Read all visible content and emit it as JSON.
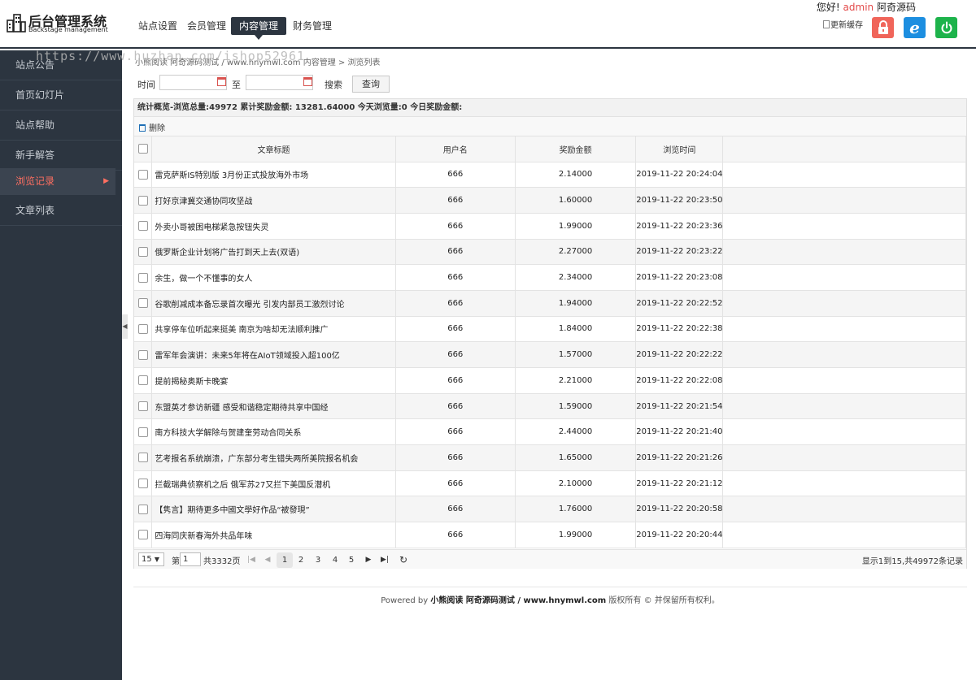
{
  "header": {
    "logo_title": "后台管理系统",
    "logo_sub": "Backstage management",
    "nav": [
      {
        "label": "站点设置"
      },
      {
        "label": "会员管理"
      },
      {
        "label": "内容管理"
      },
      {
        "label": "财务管理"
      }
    ],
    "greeting_prefix": "您好!",
    "username": "admin",
    "site_name": "阿奇源码",
    "cache_label": "更新缓存"
  },
  "sidebar": {
    "items": [
      {
        "label": "站点公告"
      },
      {
        "label": "首页幻灯片"
      },
      {
        "label": "站点帮助"
      },
      {
        "label": "新手解答"
      },
      {
        "label": "浏览记录"
      },
      {
        "label": "文章列表"
      }
    ]
  },
  "watermark": "https://www.huzhan.com/ishop52961",
  "breadcrumb": "小熊阅读 阿奇源码测试 / www.hnymwl.com 内容管理 > 浏览列表",
  "search": {
    "time_label": "时间",
    "to_label": "至",
    "search_label": "搜索",
    "query_button": "查询",
    "start_date": "",
    "end_date": ""
  },
  "stats": "统计概览-浏览总量:49972 累计奖励金额: 13281.64000 今天浏览量:0 今日奖励金额:",
  "toolbar": {
    "delete_label": "删除"
  },
  "table": {
    "columns": [
      "文章标题",
      "用户名",
      "奖励金额",
      "浏览时间"
    ],
    "rows": [
      {
        "title": "雷克萨斯IS特别版 3月份正式投放海外市场",
        "user": "666",
        "amount": "2.14000",
        "time": "2019-11-22 20:24:04"
      },
      {
        "title": "打好京津冀交通协同攻坚战",
        "user": "666",
        "amount": "1.60000",
        "time": "2019-11-22 20:23:50"
      },
      {
        "title": "外卖小哥被困电梯紧急按钮失灵",
        "user": "666",
        "amount": "1.99000",
        "time": "2019-11-22 20:23:36"
      },
      {
        "title": "俄罗斯企业计划将广告打到天上去(双语)",
        "user": "666",
        "amount": "2.27000",
        "time": "2019-11-22 20:23:22"
      },
      {
        "title": "余生，做一个不懂事的女人",
        "user": "666",
        "amount": "2.34000",
        "time": "2019-11-22 20:23:08"
      },
      {
        "title": "谷歌削减成本备忘录首次曝光 引发内部员工激烈讨论",
        "user": "666",
        "amount": "1.94000",
        "time": "2019-11-22 20:22:52"
      },
      {
        "title": "共享停车位听起来挺美 南京为啥却无法顺利推广",
        "user": "666",
        "amount": "1.84000",
        "time": "2019-11-22 20:22:38"
      },
      {
        "title": "雷军年会演讲：未来5年将在AIoT领域投入超100亿",
        "user": "666",
        "amount": "1.57000",
        "time": "2019-11-22 20:22:22"
      },
      {
        "title": "提前揭秘奥斯卡晚宴",
        "user": "666",
        "amount": "2.21000",
        "time": "2019-11-22 20:22:08"
      },
      {
        "title": "东盟英才参访新疆 感受和谐稳定期待共享中国经",
        "user": "666",
        "amount": "1.59000",
        "time": "2019-11-22 20:21:54"
      },
      {
        "title": "南方科技大学解除与贺建奎劳动合同关系",
        "user": "666",
        "amount": "2.44000",
        "time": "2019-11-22 20:21:40"
      },
      {
        "title": "艺考报名系统崩溃，广东部分考生错失两所美院报名机会",
        "user": "666",
        "amount": "1.65000",
        "time": "2019-11-22 20:21:26"
      },
      {
        "title": "拦截瑞典侦察机之后 俄军苏27又拦下美国反潜机",
        "user": "666",
        "amount": "2.10000",
        "time": "2019-11-22 20:21:12"
      },
      {
        "title": "【隽言】期待更多中國文學好作品“被發現”",
        "user": "666",
        "amount": "1.76000",
        "time": "2019-11-22 20:20:58"
      },
      {
        "title": "四海同庆新春海外共品年味",
        "user": "666",
        "amount": "1.99000",
        "time": "2019-11-22 20:20:44"
      }
    ]
  },
  "pager": {
    "page_size": "15",
    "page_prefix": "第",
    "current_page": "1",
    "total_pages_text": "共3332页",
    "pages": [
      "1",
      "2",
      "3",
      "4",
      "5"
    ],
    "info": "显示1到15,共49972条记录"
  },
  "footer": {
    "prefix": "Powered by",
    "brand": "小熊阅读 阿奇源码测试 / www.hnymwl.com",
    "suffix": "版权所有 © 并保留所有权利。"
  },
  "colors": {
    "sidebar_bg": "#2c3540",
    "active_accent": "#ff6f61",
    "lock_button": "#f0655a",
    "ie_button": "#1c8ee0",
    "power_button": "#1db34b"
  }
}
